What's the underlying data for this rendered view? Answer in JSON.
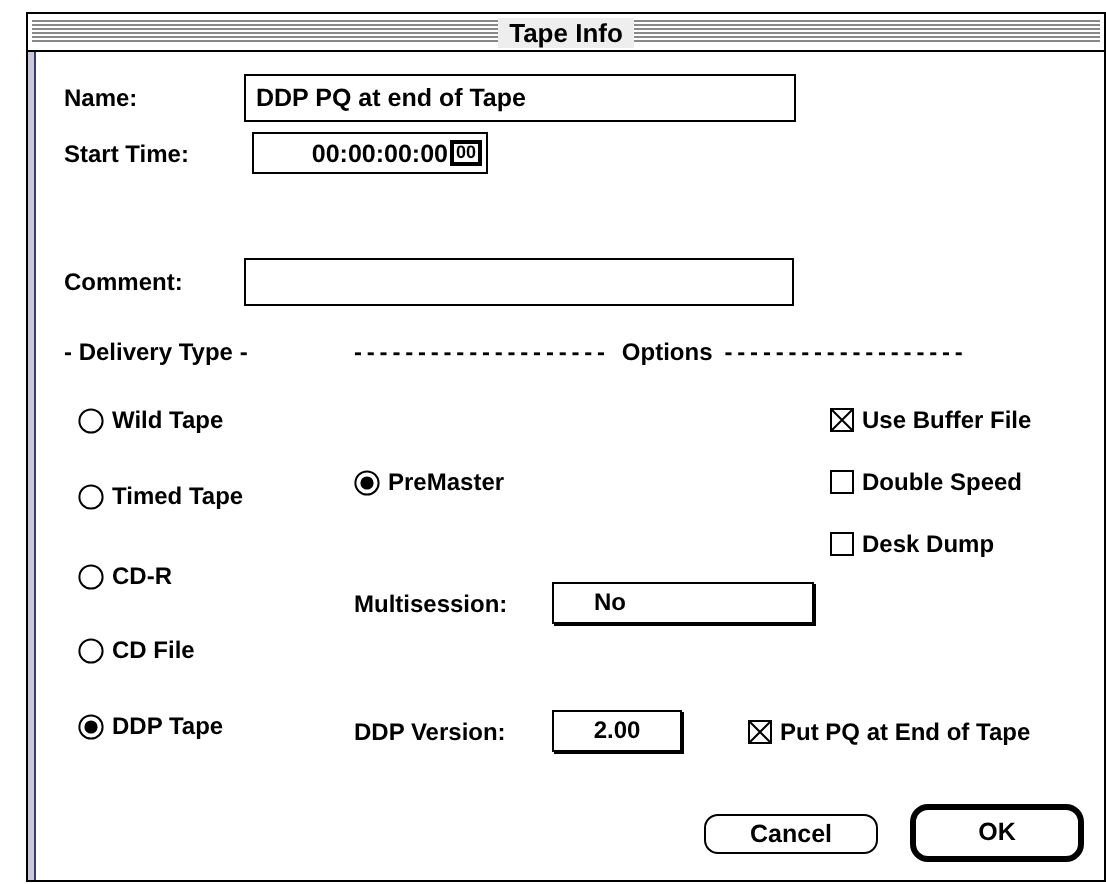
{
  "window": {
    "title": "Tape Info"
  },
  "fields": [
    {
      "label": "Name:",
      "value": "DDP PQ at end of Tape"
    },
    {
      "label": "Start Time:",
      "value": "00:00:00:00",
      "stepper": "00"
    },
    {
      "label": "Comment:"
    }
  ],
  "delivery_type": {
    "heading": "- Delivery Type -",
    "options": [
      {
        "label": "Wild Tape",
        "selected": false
      },
      {
        "label": "Timed Tape",
        "selected": false
      },
      {
        "label": "CD-R",
        "selected": false
      },
      {
        "label": "CD File",
        "selected": false
      },
      {
        "label": "DDP Tape",
        "selected": true
      }
    ]
  },
  "options": {
    "leader_left": "--------------------",
    "heading": "Options",
    "leader_right": "-------------------",
    "premaster": {
      "label": "PreMaster",
      "selected": true
    },
    "checkboxes": [
      {
        "label": "Use Buffer File",
        "checked": true
      },
      {
        "label": "Double Speed",
        "checked": false
      },
      {
        "label": "Desk Dump",
        "checked": false
      }
    ],
    "multisession": {
      "label": "Multisession:",
      "value": "No"
    },
    "ddp_version": {
      "label": "DDP Version:",
      "value": "2.00"
    },
    "put_pq": {
      "label": "Put PQ at End of Tape",
      "checked": true
    }
  },
  "buttons": [
    {
      "label": "Cancel",
      "default": false
    },
    {
      "label": "OK",
      "default": true
    }
  ]
}
